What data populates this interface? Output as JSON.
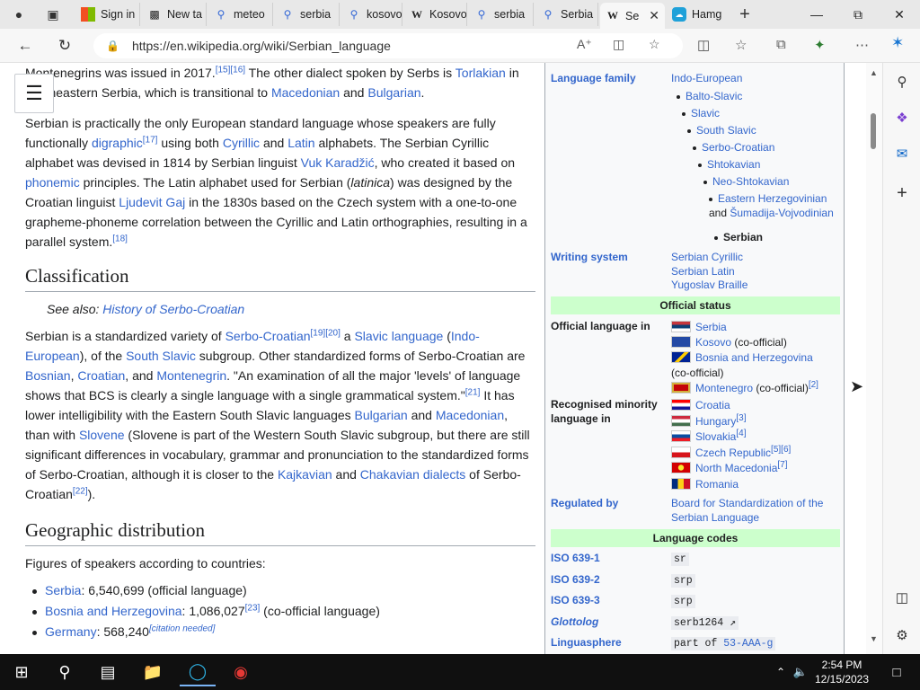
{
  "browser": {
    "tabs": [
      {
        "label": "",
        "icon": "profile-icon"
      },
      {
        "label": "",
        "icon": "tab-actions-icon"
      },
      {
        "label": "Sign in",
        "icon": "microsoft-icon"
      },
      {
        "label": "New ta",
        "icon": "newtab-icon"
      },
      {
        "label": "meteo",
        "icon": "search-icon"
      },
      {
        "label": "serbia",
        "icon": "search-icon"
      },
      {
        "label": "kosovo",
        "icon": "search-icon"
      },
      {
        "label": "Kosovo",
        "icon": "wikipedia-icon"
      },
      {
        "label": "serbia",
        "icon": "search-icon"
      },
      {
        "label": "Serbia",
        "icon": "search-icon"
      },
      {
        "label": "Se",
        "icon": "wikipedia-icon"
      },
      {
        "label": "Hamg",
        "icon": "copilot-icon"
      }
    ],
    "url": "https://en.wikipedia.org/wiki/Serbian_language"
  },
  "article": {
    "p1": {
      "a": "Montenegrins was issued in 2017.",
      "ref1": "[15][16]",
      "b": " The other dialect spoken by Serbs is ",
      "l1": "Torlakian",
      "c": " in southeastern Serbia, which is transitional to ",
      "l2": "Macedonian",
      "d": " and ",
      "l3": "Bulgarian",
      "e": "."
    },
    "p2": {
      "a": "Serbian is practically the only European standard language whose speakers are fully functionally ",
      "l1": "digraphic",
      "ref1": "[17]",
      "b": " using both ",
      "l2": "Cyrillic",
      "c": " and ",
      "l3": "Latin",
      "d": " alphabets. The Serbian Cyrillic alphabet was devised in 1814 by Serbian linguist ",
      "l4": "Vuk Karadžić",
      "e": ", who created it based on ",
      "l5": "phonemic",
      "f": " principles. The Latin alphabet used for Serbian (",
      "it": "latinica",
      "g": ") was designed by the Croatian linguist ",
      "l6": "Ljudevit Gaj",
      "h": " in the 1830s based on the Czech system with a one-to-one grapheme-phoneme correlation between the Cyrillic and Latin orthographies, resulting in a parallel system.",
      "ref2": "[18]"
    },
    "h_classification": "Classification",
    "hatnote_prefix": "See also: ",
    "hatnote_link": "History of Serbo-Croatian",
    "p3": {
      "a": "Serbian is a standardized variety of ",
      "l1": "Serbo-Croatian",
      "ref1": "[19][20]",
      "b": " a ",
      "l2": "Slavic language",
      "c": " (",
      "l3": "Indo-European",
      "d": "), of the ",
      "l4": "South Slavic",
      "e": " subgroup. Other standardized forms of Serbo-Croatian are ",
      "l5": "Bosnian",
      "f": ", ",
      "l6": "Croatian",
      "g": ", and ",
      "l7": "Montenegrin",
      "h": ". \"An examination of all the major 'levels' of language shows that BCS is clearly a single language with a single grammatical system.\"",
      "ref2": "[21]",
      "i": " It has lower intelligibility with the Eastern South Slavic languages ",
      "l8": "Bulgarian",
      "j": " and ",
      "l9": "Macedonian",
      "k": ", than with ",
      "l10": "Slovene",
      "l": " (Slovene is part of the Western South Slavic subgroup, but there are still significant differences in vocabulary, grammar and pronunciation to the standardized forms of Serbo-Croatian, although it is closer to the ",
      "l11": "Kajkavian",
      "m": " and ",
      "l12": "Chakavian dialects",
      "n": " of Serbo-Croatian",
      "ref3": "[22]",
      "o": ")."
    },
    "h_geo": "Geographic distribution",
    "geo_intro": "Figures of speakers according to countries:",
    "speakers": [
      {
        "country": "Serbia",
        "rest": ": 6,540,699 (official language)",
        "ref": ""
      },
      {
        "country": "Bosnia and Herzegovina",
        "rest": ": 1,086,027",
        "ref": "[23]",
        "tail": " (co-official language)"
      },
      {
        "country": "Germany",
        "rest": ": 568,240",
        "ref": "[citation needed]",
        "tail": ""
      }
    ]
  },
  "infobox": {
    "family_label": "Language family",
    "family": [
      "Indo-European",
      "Balto-Slavic",
      "Slavic",
      "South Slavic",
      "Serbo-Croatian",
      "Shtokavian",
      "Neo-Shtokavian"
    ],
    "family_eh1": "Eastern Herzegovinian",
    "family_and": " and ",
    "family_eh2": "Šumadija-Vojvodinian",
    "family_last": "Serbian",
    "writing_label": "Writing system",
    "writing": [
      "Serbian Cyrillic",
      "Serbian Latin",
      "Yugoslav Braille"
    ],
    "official_head": "Official status",
    "official_label": "Official language in",
    "official": [
      {
        "name": "Serbia",
        "note": "",
        "ref": ""
      },
      {
        "name": "Kosovo",
        "note": " (co-official)",
        "ref": ""
      },
      {
        "name": "Bosnia and Herzegovina",
        "note": "(co-official)",
        "ref": ""
      },
      {
        "name": "Montenegro",
        "note": " (co-official)",
        "ref": "[2]"
      }
    ],
    "minority_label": "Recognised minority language in",
    "minority": [
      {
        "name": "Croatia",
        "ref": ""
      },
      {
        "name": "Hungary",
        "ref": "[3]"
      },
      {
        "name": "Slovakia",
        "ref": "[4]"
      },
      {
        "name": "Czech Republic",
        "ref": "[5][6]"
      },
      {
        "name": "North Macedonia",
        "ref": "[7]"
      },
      {
        "name": "Romania",
        "ref": ""
      }
    ],
    "regulated_label": "Regulated by",
    "regulated": "Board for Standardization of the Serbian Language",
    "codes_head": "Language codes",
    "iso1_label": "ISO 639-1",
    "iso1": "sr",
    "iso2_label": "ISO 639-2",
    "iso2": "srp",
    "iso3_label": "ISO 639-3",
    "iso3": "srp",
    "glotto_label": "Glottolog",
    "glotto": "serb1264",
    "lingua_label": "Linguasphere",
    "lingua_pre": "part of ",
    "lingua_link": "53-AAA-g"
  },
  "taskbar": {
    "time": "2:54 PM",
    "date": "12/15/2023"
  }
}
